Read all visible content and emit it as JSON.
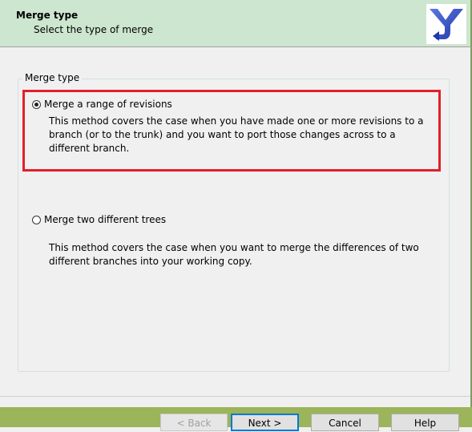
{
  "header": {
    "title": "Merge type",
    "subtitle": "Select the type of merge",
    "logo_icon": "tortoise-merge-logo-icon"
  },
  "group": {
    "legend": "Merge type"
  },
  "options": [
    {
      "label": "Merge a range of revisions",
      "selected": true,
      "description": "This method covers the case when you have made one or more revisions to a branch (or to the trunk) and you want to port those changes across to a different branch."
    },
    {
      "label": "Merge two different trees",
      "selected": false,
      "description": "This method covers the case when you want to merge the differences of two different branches into your working copy."
    }
  ],
  "buttons": {
    "back": "< Back",
    "next": "Next >",
    "cancel": "Cancel",
    "help": "Help"
  },
  "colors": {
    "header_bg": "#cde6cf",
    "highlight": "#e0202a",
    "footer_bg": "#9cb45a",
    "logo_blue": "#3a54c8"
  }
}
